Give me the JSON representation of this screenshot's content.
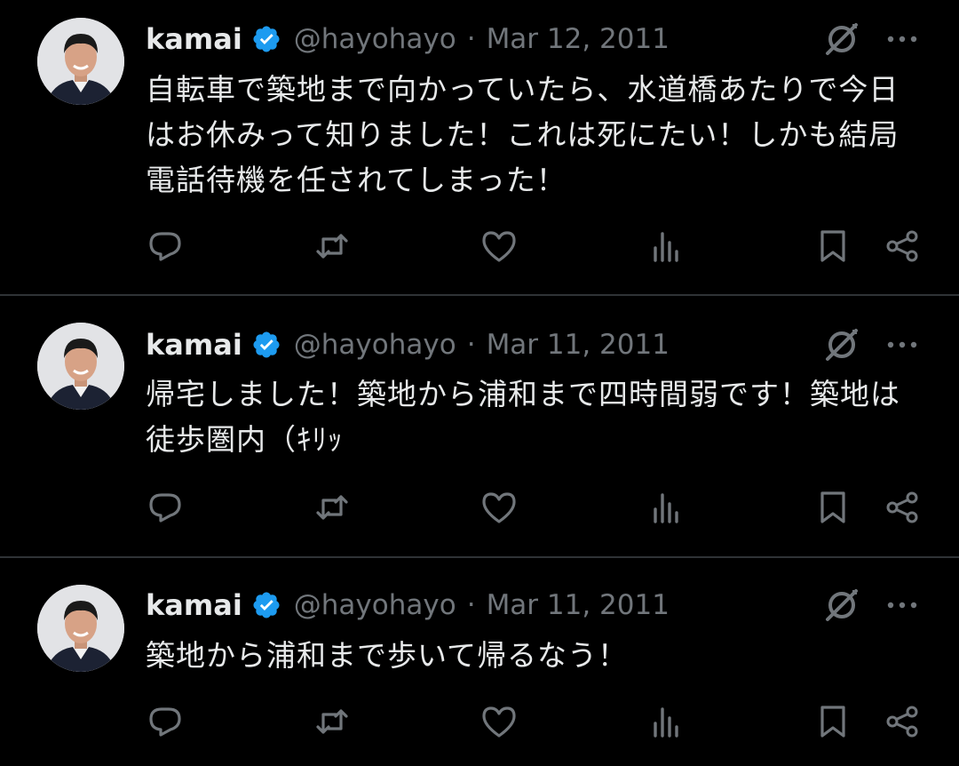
{
  "colors": {
    "background": "#000000",
    "text": "#e7e9ea",
    "muted": "#71767b",
    "verified": "#1d9bf0",
    "divider": "#2f3336"
  },
  "icons": {
    "verified": "verified-badge-icon",
    "grok": "grok-icon",
    "more": "more-horizontal-icon",
    "reply": "reply-icon",
    "retweet": "retweet-icon",
    "like": "like-icon",
    "views": "views-icon",
    "bookmark": "bookmark-icon",
    "share": "share-icon"
  },
  "tweets": [
    {
      "name": "kamai",
      "handle": "@hayohayo",
      "separator": "·",
      "date": "Mar 12, 2011",
      "text": "自転車で築地まで向かっていたら、水道橋あたりで今日はお休みって知りました！これは死にたい！しかも結局電話待機を任されてしまった！"
    },
    {
      "name": "kamai",
      "handle": "@hayohayo",
      "separator": "·",
      "date": "Mar 11, 2011",
      "text": "帰宅しました！築地から浦和まで四時間弱です！築地は徒歩圏内（ｷﾘｯ"
    },
    {
      "name": "kamai",
      "handle": "@hayohayo",
      "separator": "·",
      "date": "Mar 11, 2011",
      "text": "築地から浦和まで歩いて帰るなう！"
    }
  ]
}
